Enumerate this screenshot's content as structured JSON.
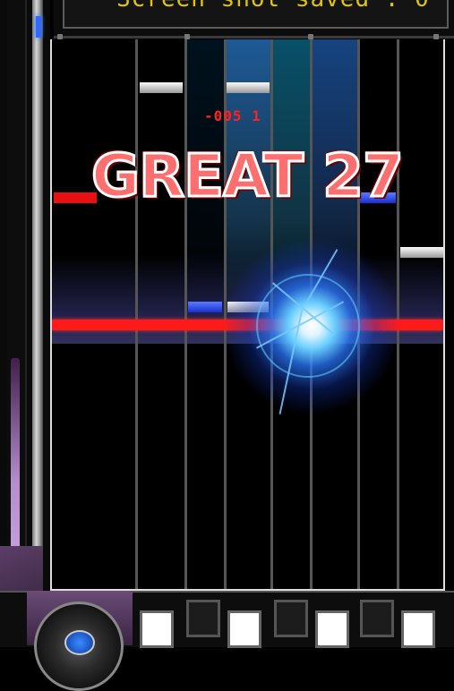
{
  "status_text": "Screen shot saved : 0",
  "timing_offset": "-005 1",
  "judgement": {
    "label": "GREAT",
    "combo": "27"
  },
  "colors": {
    "judge_line": "#ff1a1a",
    "judgement_fill": "#ff6f6f",
    "status_text": "#e0c600",
    "blue_note": "#1a2fd0",
    "white_note": "#fafafa"
  },
  "keys": [
    "white",
    "black",
    "white",
    "black",
    "white",
    "black",
    "white"
  ]
}
